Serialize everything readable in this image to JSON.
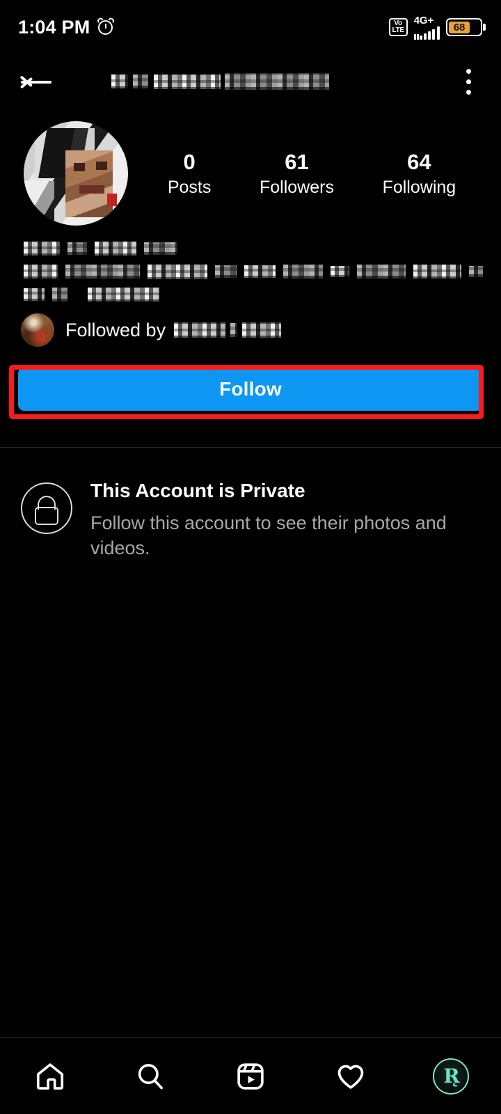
{
  "status_bar": {
    "time": "1:04 PM",
    "alarm_icon": "alarm-clock-icon",
    "volte_line1": "Vo",
    "volte_line2": "LTE",
    "network_type": "4G+",
    "signal_icon": "signal-bars-icon",
    "battery_percent": "68",
    "battery_color": "#E8A33D"
  },
  "header": {
    "back_icon": "back-arrow-icon",
    "username": "",
    "username_redacted": true,
    "menu_icon": "three-dot-menu-icon"
  },
  "profile": {
    "avatar_name": "profile-picture",
    "avatar_redacted": true,
    "stats": [
      {
        "value": "0",
        "label": "Posts"
      },
      {
        "value": "61",
        "label": "Followers"
      },
      {
        "value": "64",
        "label": "Following"
      }
    ],
    "bio_lines_redacted": [
      {
        "blocks": [
          52,
          28,
          60,
          48
        ]
      },
      {
        "blocks": [
          54,
          118,
          96,
          34,
          50,
          62,
          30,
          78,
          76,
          22
        ]
      },
      {
        "blocks": [
          30,
          22,
          104
        ]
      }
    ]
  },
  "followed_by": {
    "label": "Followed by",
    "avatar_name": "mutual-follower-avatar",
    "username_redacted": true,
    "username_blocks": [
      74,
      10,
      56
    ]
  },
  "follow_button": {
    "label": "Follow",
    "color": "#0D96F2",
    "highlight_color": "#FF1A1A",
    "highlighted": true
  },
  "private_notice": {
    "lock_icon": "lock-icon",
    "title": "This Account is Private",
    "subtitle": "Follow this account to see their photos and videos."
  },
  "bottom_nav": {
    "items": [
      {
        "name": "home-icon",
        "label": "Home"
      },
      {
        "name": "search-icon",
        "label": "Search"
      },
      {
        "name": "reels-icon",
        "label": "Reels"
      },
      {
        "name": "heart-icon",
        "label": "Activity"
      },
      {
        "name": "profile-avatar-icon",
        "label": "Profile",
        "monogram": "R̨"
      }
    ],
    "accent_color": "#6FE3C2"
  }
}
